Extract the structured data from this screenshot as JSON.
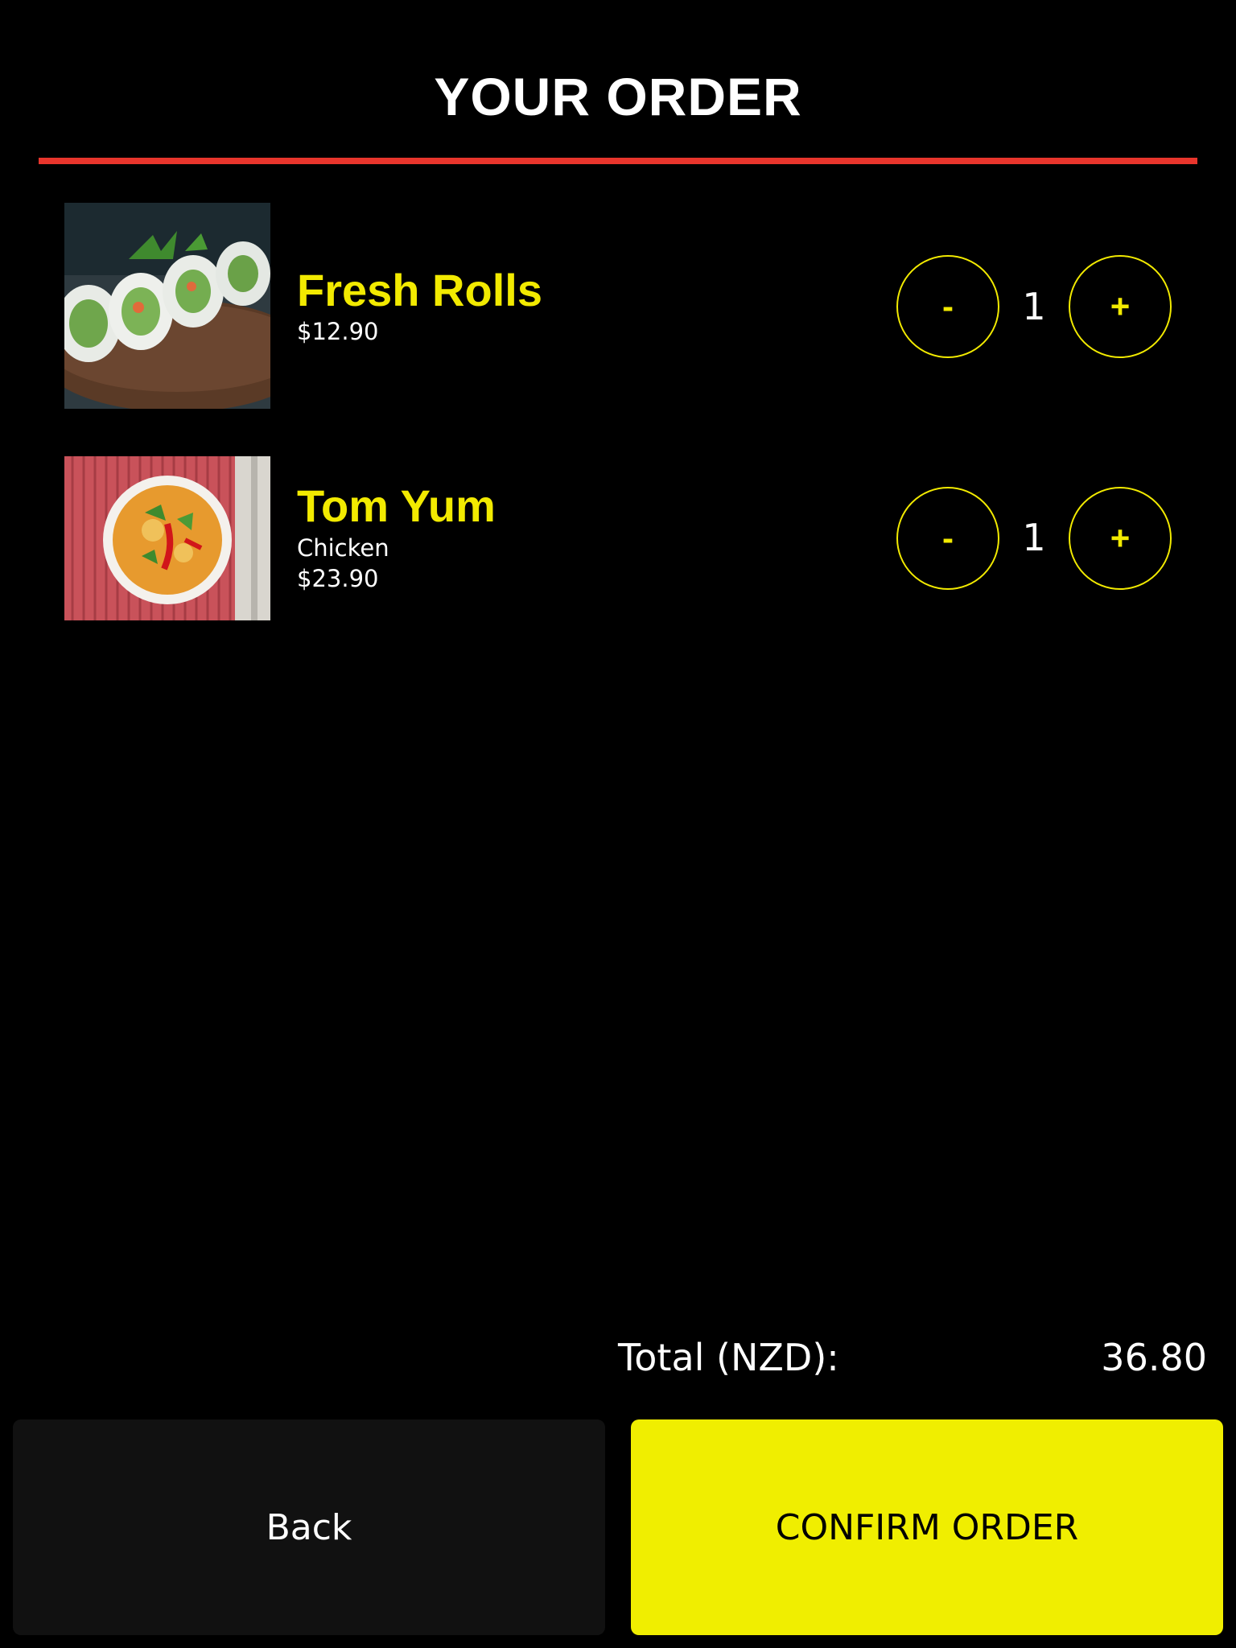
{
  "header": {
    "title": "YOUR ORDER"
  },
  "colors": {
    "accent_yellow": "#f2ea00",
    "divider_red": "#e8352c",
    "background": "#000000"
  },
  "order": {
    "items": [
      {
        "name": "Fresh Rolls",
        "option": "",
        "price": "$12.90",
        "quantity": "1",
        "minus_label": "-",
        "plus_label": "+"
      },
      {
        "name": "Tom Yum",
        "option": "Chicken",
        "price": "$23.90",
        "quantity": "1",
        "minus_label": "-",
        "plus_label": "+"
      }
    ]
  },
  "summary": {
    "total_label": "Total (NZD):",
    "total_value": "36.80"
  },
  "actions": {
    "back_label": "Back",
    "confirm_label": "CONFIRM ORDER"
  }
}
